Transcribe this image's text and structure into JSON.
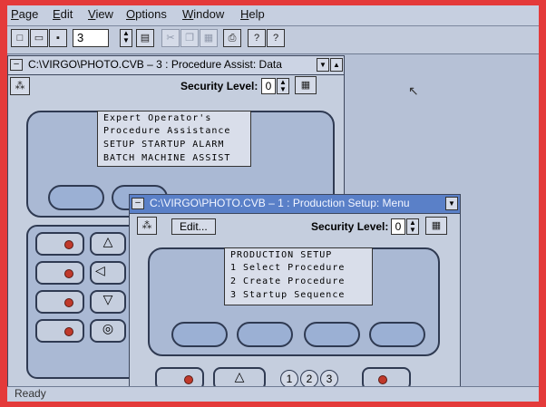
{
  "menubar": {
    "items": [
      "Page",
      "Edit",
      "View",
      "Options",
      "Window",
      "Help"
    ]
  },
  "toolbar": {
    "page_number": "3"
  },
  "window_back": {
    "title": "C:\\VIRGO\\PHOTO.CVB – 3   : Procedure Assist: Data",
    "security_label": "Security Level:",
    "security_value": "0",
    "menu_lines": [
      "Expert Operator's",
      "Procedure Assistance",
      "SETUP STARTUP ALARM",
      "BATCH MACHINE ASSIST"
    ]
  },
  "window_front": {
    "title": "C:\\VIRGO\\PHOTO.CVB – 1   : Production Setup: Menu",
    "edit_label": "Edit...",
    "security_label": "Security Level:",
    "security_value": "0",
    "menu_lines": [
      "PRODUCTION SETUP",
      "1 Select Procedure",
      "2 Create Procedure",
      "3 Startup Sequence"
    ],
    "keypad": [
      "1",
      "2",
      "3"
    ]
  },
  "statusbar": {
    "text": "Ready"
  },
  "colors": {
    "frame": "#e43a3a",
    "desktop": "#b6c1d6",
    "active_title": "#5a80c8",
    "led": "#c0392b"
  }
}
